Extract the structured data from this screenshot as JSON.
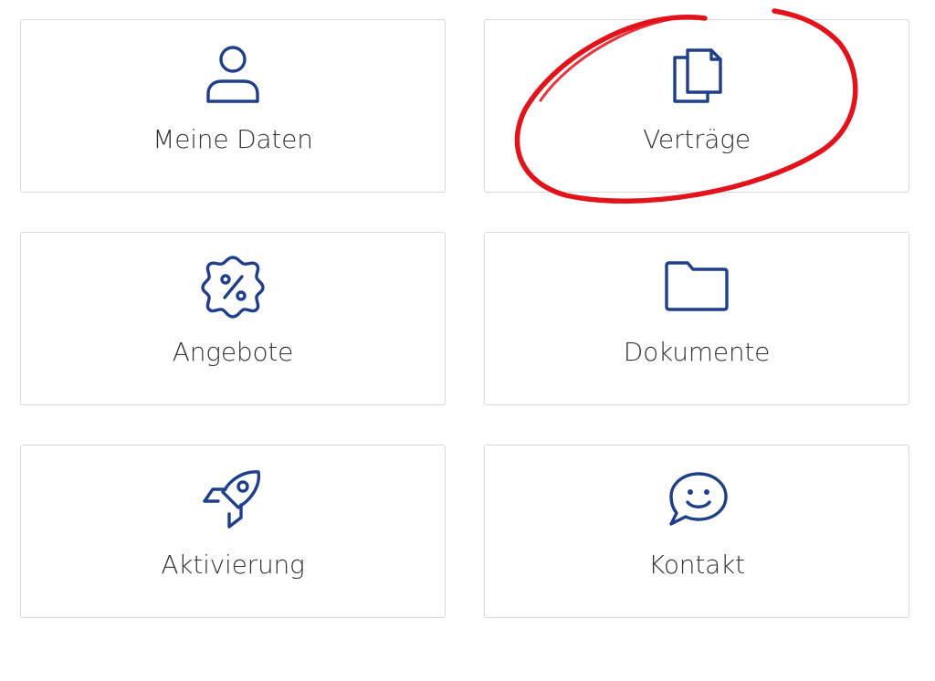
{
  "tiles": [
    {
      "label": "Meine Daten",
      "icon": "user-icon"
    },
    {
      "label": "Verträge",
      "icon": "documents-copy-icon"
    },
    {
      "label": "Angebote",
      "icon": "percent-badge-icon"
    },
    {
      "label": "Dokumente",
      "icon": "folder-icon"
    },
    {
      "label": "Aktivierung",
      "icon": "rocket-icon"
    },
    {
      "label": "Kontakt",
      "icon": "chat-smile-icon"
    }
  ],
  "colors": {
    "icon": "#1f3f8c",
    "label": "#333333",
    "border": "#d8d8d8",
    "annotation": "#e3131b"
  },
  "annotation": {
    "type": "hand-drawn-circle",
    "target": "Verträge"
  }
}
